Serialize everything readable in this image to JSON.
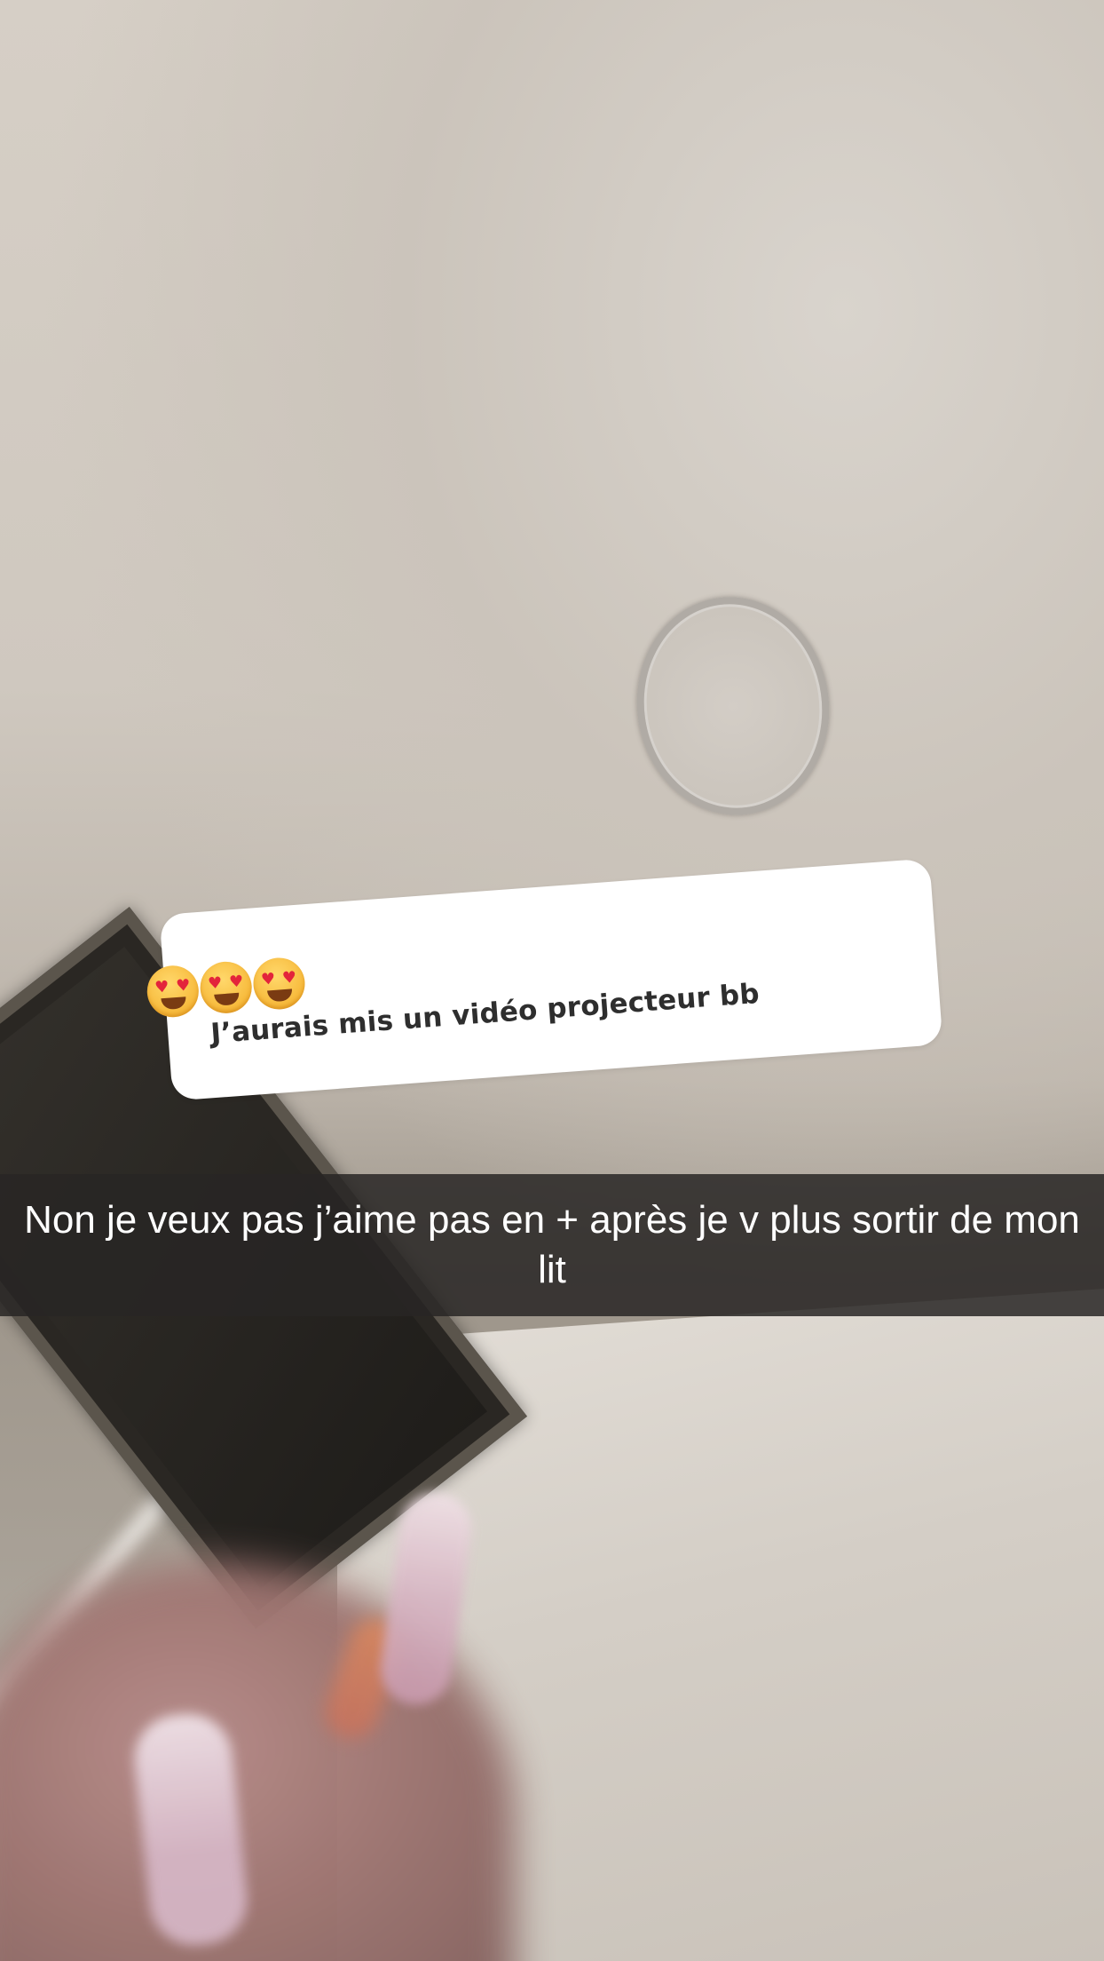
{
  "sticker": {
    "emojis": [
      "heart-eyes-emoji",
      "heart-eyes-emoji",
      "heart-eyes-emoji"
    ],
    "text": "J’aurais mis un vidéo projecteur bb"
  },
  "caption": {
    "text": "Non je veux pas j’aime pas en + après je v plus sortir de mon lit"
  },
  "colors": {
    "caption_background": "#282624",
    "caption_text": "#ffffff",
    "sticker_background": "#ffffff",
    "sticker_text": "#2e2e2e"
  }
}
